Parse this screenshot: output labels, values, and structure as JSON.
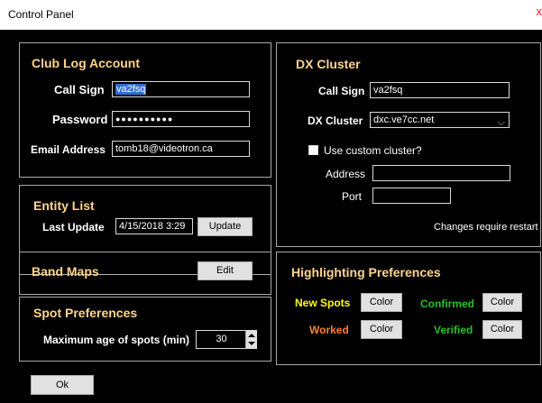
{
  "window": {
    "title": "Control Panel",
    "close_glyph": "x"
  },
  "club_log": {
    "title": "Club Log Account",
    "call_sign_label": "Call Sign",
    "call_sign_value": "va2fsq",
    "password_label": "Password",
    "password_value": "●●●●●●●●●●",
    "email_label": "Email Address",
    "email_value": "tomb18@videotron.ca"
  },
  "entity_list": {
    "title": "Entity List",
    "last_update_label": "Last Update",
    "last_update_value": "4/15/2018 3:29",
    "update_button": "Update"
  },
  "band_maps": {
    "title": "Band Maps",
    "edit_button": "Edit"
  },
  "spot_prefs": {
    "title": "Spot Preferences",
    "max_age_label": "Maximum age of spots (min)",
    "max_age_value": "30"
  },
  "dx_cluster": {
    "title": "DX Cluster",
    "call_sign_label": "Call Sign",
    "call_sign_value": "va2fsq",
    "cluster_label": "DX Cluster",
    "cluster_value": "dxc.ve7cc.net",
    "custom_label": "Use custom cluster?",
    "address_label": "Address",
    "address_value": "",
    "port_label": "Port",
    "port_value": "",
    "restart_note": "Changes require restart"
  },
  "highlighting": {
    "title": "Highlighting Preferences",
    "new_spots_label": "New Spots",
    "confirmed_label": "Confirmed",
    "worked_label": "Worked",
    "verified_label": "Verified",
    "color_button": "Color"
  },
  "ok_button": "Ok",
  "colors": {
    "group_title": "#ffd48a",
    "new_spots": "#ffff00",
    "confirmed": "#22c322",
    "worked": "#ff7f27",
    "verified": "#22c322"
  }
}
